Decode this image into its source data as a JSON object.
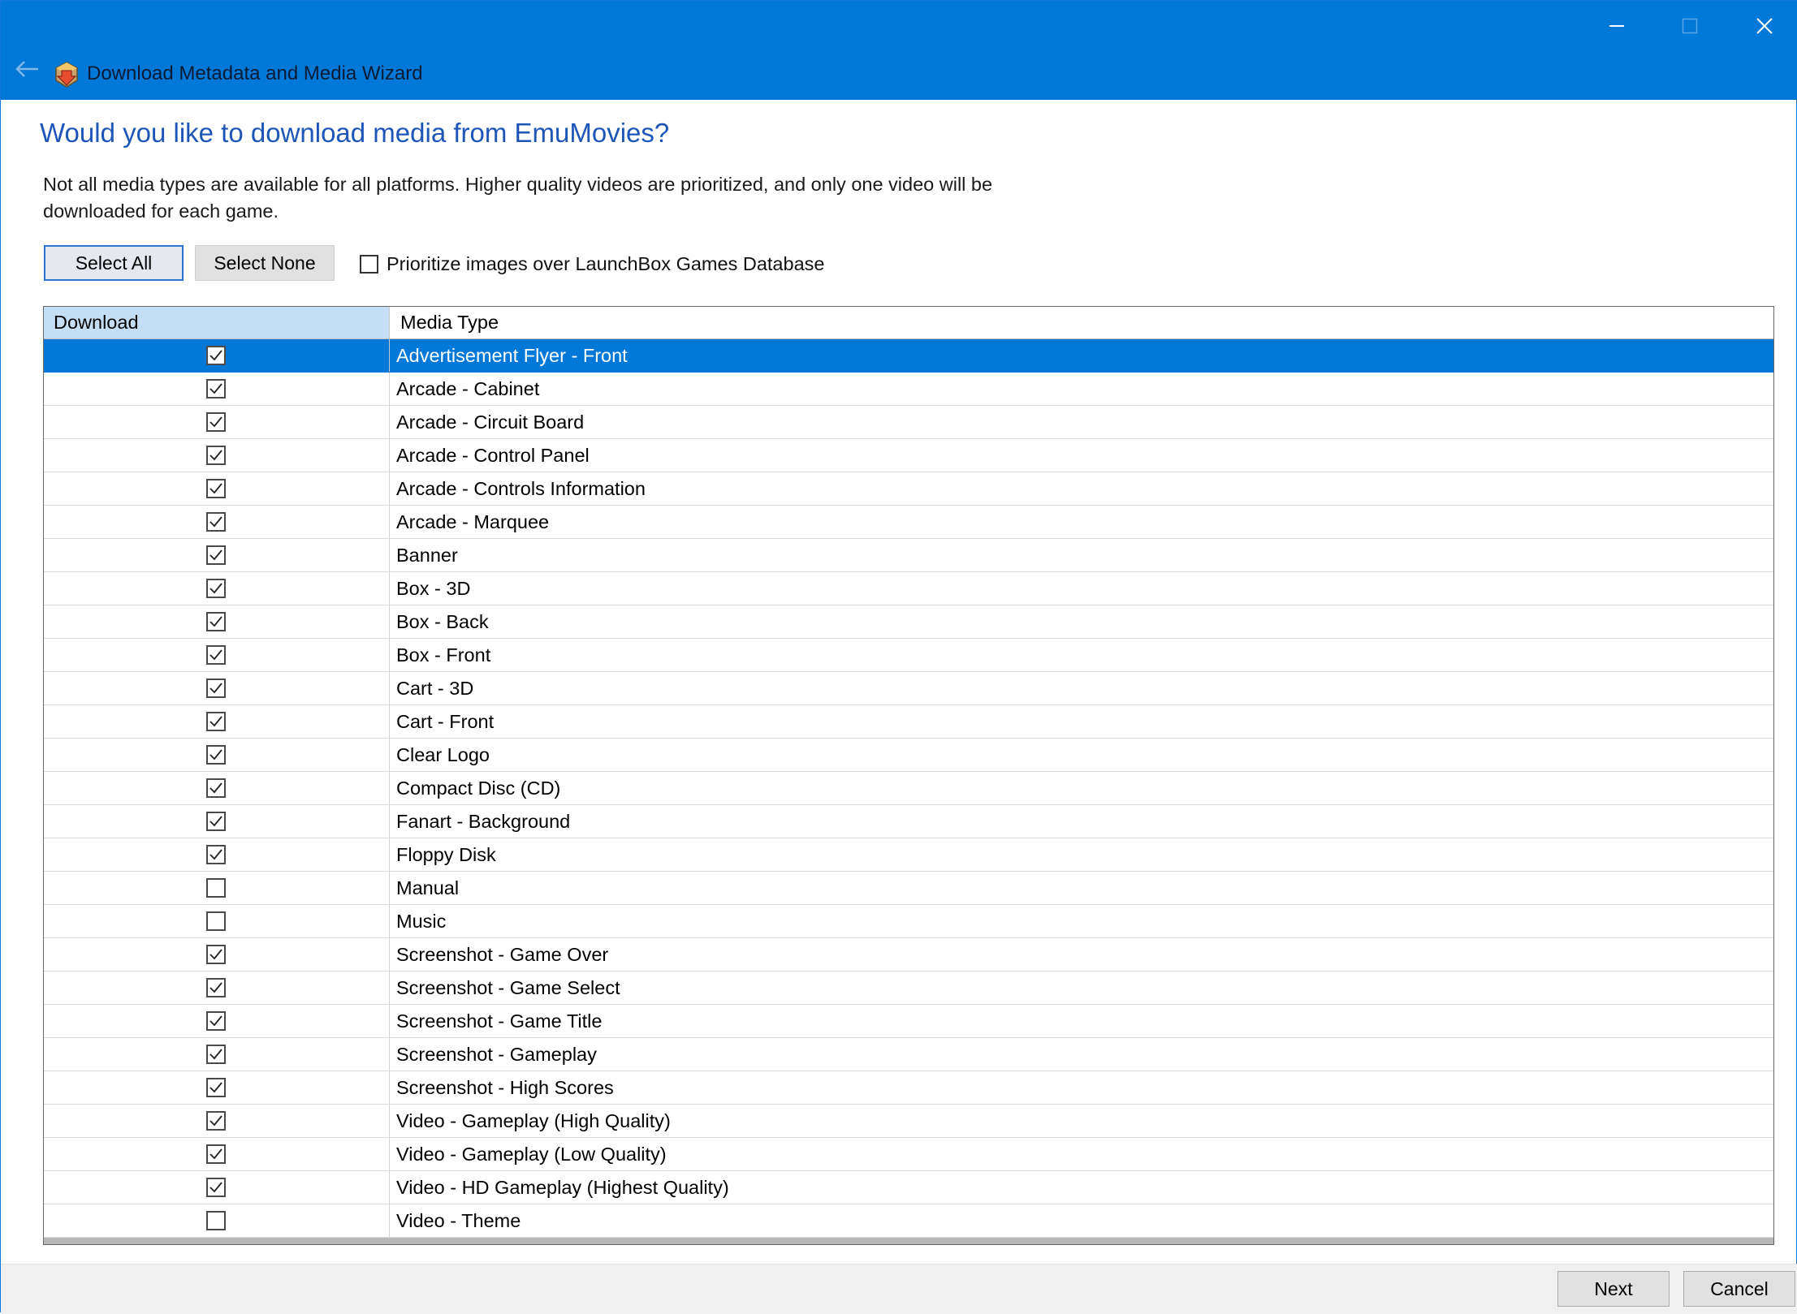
{
  "window": {
    "title": "Download Metadata and Media Wizard",
    "accent_color": "#0078d7",
    "controls": [
      "minimize-icon",
      "maximize-icon",
      "close-icon"
    ]
  },
  "page": {
    "heading": "Would you like to download media from EmuMovies?",
    "description": "Not all media types are available for all platforms. Higher quality videos are prioritized, and only one video will be downloaded for each game."
  },
  "toolbar": {
    "select_all": "Select All",
    "select_none": "Select None",
    "prioritize_label": "Prioritize images over LaunchBox Games Database",
    "prioritize_checked": false
  },
  "grid": {
    "columns": [
      "Download",
      "Media Type"
    ],
    "rows": [
      {
        "checked": true,
        "media_type": "Advertisement Flyer - Front",
        "selected": true
      },
      {
        "checked": true,
        "media_type": "Arcade - Cabinet"
      },
      {
        "checked": true,
        "media_type": "Arcade - Circuit Board"
      },
      {
        "checked": true,
        "media_type": "Arcade - Control Panel"
      },
      {
        "checked": true,
        "media_type": "Arcade - Controls Information"
      },
      {
        "checked": true,
        "media_type": "Arcade - Marquee"
      },
      {
        "checked": true,
        "media_type": "Banner"
      },
      {
        "checked": true,
        "media_type": "Box - 3D"
      },
      {
        "checked": true,
        "media_type": "Box - Back"
      },
      {
        "checked": true,
        "media_type": "Box - Front"
      },
      {
        "checked": true,
        "media_type": "Cart - 3D"
      },
      {
        "checked": true,
        "media_type": "Cart - Front"
      },
      {
        "checked": true,
        "media_type": "Clear Logo"
      },
      {
        "checked": true,
        "media_type": "Compact Disc (CD)"
      },
      {
        "checked": true,
        "media_type": "Fanart - Background"
      },
      {
        "checked": true,
        "media_type": "Floppy Disk"
      },
      {
        "checked": false,
        "media_type": "Manual"
      },
      {
        "checked": false,
        "media_type": "Music"
      },
      {
        "checked": true,
        "media_type": "Screenshot - Game Over"
      },
      {
        "checked": true,
        "media_type": "Screenshot - Game Select"
      },
      {
        "checked": true,
        "media_type": "Screenshot - Game Title"
      },
      {
        "checked": true,
        "media_type": "Screenshot - Gameplay"
      },
      {
        "checked": true,
        "media_type": "Screenshot - High Scores"
      },
      {
        "checked": true,
        "media_type": "Video - Gameplay (High Quality)"
      },
      {
        "checked": true,
        "media_type": "Video - Gameplay (Low Quality)"
      },
      {
        "checked": true,
        "media_type": "Video - HD Gameplay (Highest Quality)"
      },
      {
        "checked": false,
        "media_type": "Video - Theme"
      }
    ]
  },
  "footer": {
    "next": "Next",
    "cancel": "Cancel"
  }
}
